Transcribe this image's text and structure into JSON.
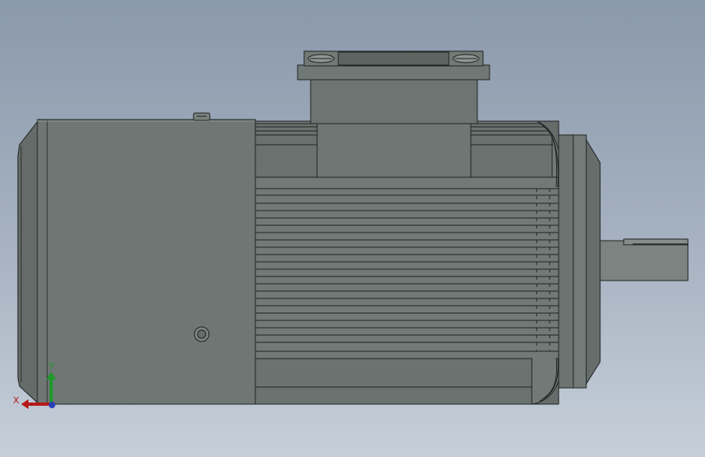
{
  "viewport": {
    "background_top": "#8a99ab",
    "background_bottom": "#c6cfd9"
  },
  "model": {
    "type": "electric-motor",
    "view": "front",
    "body_color": "#6e7673",
    "edge_color": "#1f2422"
  },
  "triad": {
    "x_label": "X",
    "y_label": "Y",
    "x_color": "#b51a1a",
    "y_color": "#1f9a2a",
    "z_color": "#2a3fb8"
  }
}
